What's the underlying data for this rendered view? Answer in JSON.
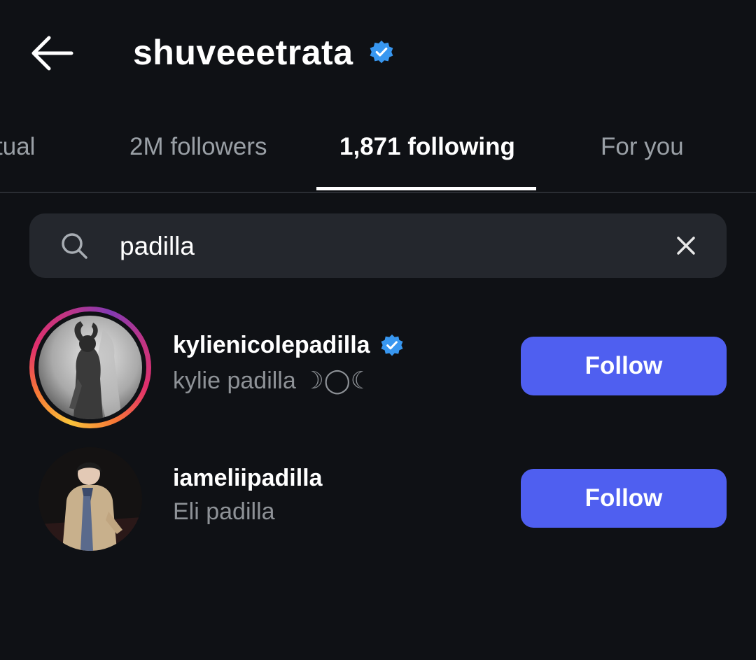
{
  "header": {
    "title": "shuveeetrata",
    "verified_icon": "verified-badge-icon",
    "back_icon": "arrow-left-icon"
  },
  "tabs": [
    {
      "label": "tual",
      "active": false
    },
    {
      "label": "2M followers",
      "active": false
    },
    {
      "label": "1,871 following",
      "active": true
    },
    {
      "label": "For you",
      "active": false
    }
  ],
  "search": {
    "value": "padilla",
    "placeholder": "Search",
    "icon": "search-icon",
    "clear_icon": "close-icon"
  },
  "results": [
    {
      "username": "kylienicolepadilla",
      "full_name": "kylie padilla ☽◯☾",
      "verified": true,
      "has_story_ring": true,
      "button_label": "Follow"
    },
    {
      "username": "iameliipadilla",
      "full_name": "Eli padilla",
      "verified": false,
      "has_story_ring": false,
      "button_label": "Follow"
    }
  ],
  "colors": {
    "background": "#0f1115",
    "accent": "#4f5ff0",
    "verified": "#3897f0",
    "search_bg": "#24272d",
    "muted_text": "#8e9297"
  }
}
